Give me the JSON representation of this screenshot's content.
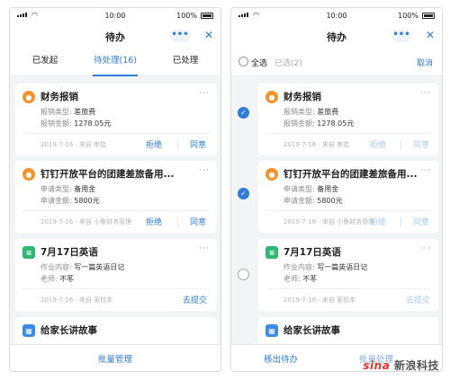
{
  "statusbar": {
    "time": "10:00",
    "battery": "100%"
  },
  "left": {
    "title": "待办",
    "more_label": "•••",
    "close_label": "✕",
    "tabs": [
      {
        "label": "已发起"
      },
      {
        "label": "待处理(16)"
      },
      {
        "label": "已处理"
      }
    ],
    "cards": [
      {
        "title": "财务报销",
        "icon": "person-icon",
        "line1_key": "报销类型:",
        "line1_val": "差旅费",
        "line2_key": "报销金额:",
        "line2_val": "1278.05元",
        "meta": "2019-7-16 · 来自 审批",
        "reject": "拒绝",
        "approve": "同意"
      },
      {
        "title": "钉钉开放平台的团建差旅备用...",
        "icon": "person-icon",
        "line1_key": "申请类型:",
        "line1_val": "备用金",
        "line2_key": "申请金额:",
        "line2_val": "5800元",
        "meta": "2019-7-16 · 来自 小鲁财务管理",
        "reject": "拒绝",
        "approve": "同意"
      },
      {
        "title": "7月17日英语",
        "icon": "document-icon",
        "line1_key": "作业内容:",
        "line1_val": "写一篇英语日记",
        "line2_key": "老师:",
        "line2_val": "不苳",
        "meta": "2019-7-16 · 来自 家校本",
        "submit": "去提交"
      },
      {
        "title": "给家长讲故事",
        "icon": "calendar-icon"
      }
    ],
    "bottom": {
      "batch": "批量管理"
    }
  },
  "right": {
    "title": "待办",
    "more_label": "•••",
    "close_label": "✕",
    "select_all": "全选",
    "selected_count": "已选(2)",
    "cancel": "取消",
    "cards": [
      {
        "title": "财务报销",
        "line1_key": "报销类型:",
        "line1_val": "差旅费",
        "line2_key": "报销金额:",
        "line2_val": "1278.05元",
        "meta": "2019-7-16 · 来自 审批",
        "reject": "拒绝",
        "approve": "同意",
        "checked": true
      },
      {
        "title": "钉钉开放平台的团建差旅备用...",
        "line1_key": "申请类型:",
        "line1_val": "备用金",
        "line2_key": "申请金额:",
        "line2_val": "5800元",
        "meta": "2019-7-16 · 来自 小鲁财务管理",
        "reject": "拒绝",
        "approve": "同意",
        "checked": true
      },
      {
        "title": "7月17日英语",
        "line1_key": "作业内容:",
        "line1_val": "写一篇英语日记",
        "line2_key": "老师:",
        "line2_val": "不苳",
        "meta": "2019-7-16 · 来自 家校本",
        "submit": "去提交",
        "checked": false
      },
      {
        "title": "给家长讲故事"
      }
    ],
    "bottom": {
      "remove": "移出待办",
      "process": "批量处理"
    }
  },
  "watermark": {
    "logo": "sina",
    "text": "新浪科技"
  },
  "colors": {
    "accent": "#2e7bd9",
    "orange": "#f4922b",
    "green": "#2eb872",
    "blue": "#3d8be8"
  }
}
